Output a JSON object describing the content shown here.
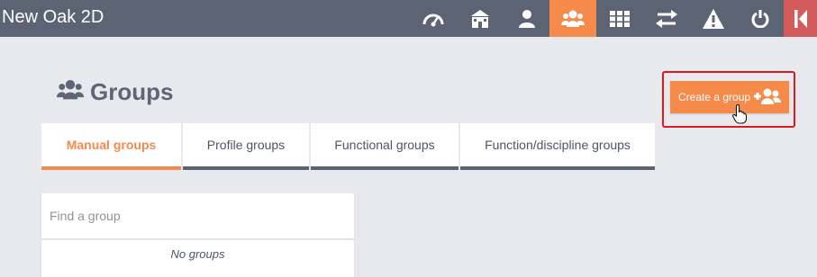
{
  "app": {
    "title": "New Oak 2D"
  },
  "nav": {
    "items": [
      {
        "icon": "dashboard-gauge-icon",
        "active": false
      },
      {
        "icon": "school-building-icon",
        "active": false
      },
      {
        "icon": "user-icon",
        "active": false
      },
      {
        "icon": "users-group-icon",
        "active": true
      },
      {
        "icon": "grid-apps-icon",
        "active": false
      },
      {
        "icon": "transfer-arrows-icon",
        "active": false
      },
      {
        "icon": "warning-triangle-icon",
        "active": false
      },
      {
        "icon": "power-icon",
        "active": false
      }
    ],
    "exit_icon": "collapse-left-icon"
  },
  "page": {
    "title": "Groups",
    "icon": "users-group-icon",
    "create_button": {
      "label": "Create a group",
      "icon": "add-user-group-icon"
    }
  },
  "tabs": [
    {
      "label": "Manual groups",
      "active": true
    },
    {
      "label": "Profile groups",
      "active": false
    },
    {
      "label": "Functional groups",
      "active": false
    },
    {
      "label": "Function/discipline groups",
      "active": false
    }
  ],
  "search": {
    "placeholder": "Find a group",
    "value": ""
  },
  "empty_state": "No groups",
  "colors": {
    "topbar": "#5c6474",
    "accent": "#f58a4b",
    "exit": "#d35b5b",
    "highlight": "#e0191f",
    "background": "#e8e9ec"
  }
}
